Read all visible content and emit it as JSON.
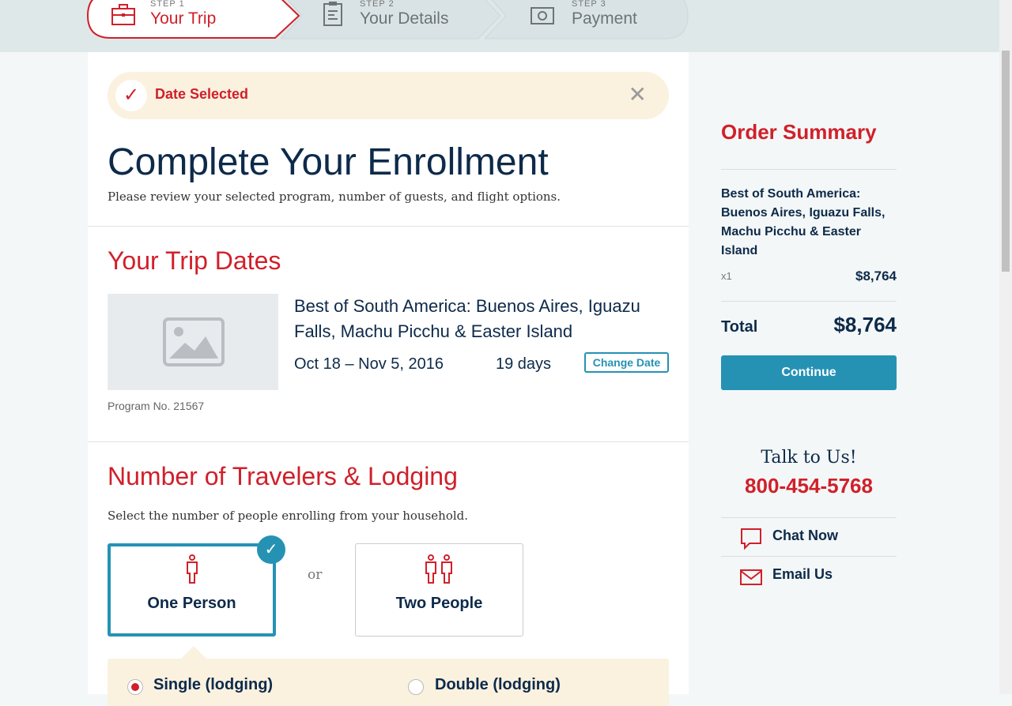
{
  "steps": [
    {
      "label": "STEP 1",
      "title": "Your Trip",
      "icon": "briefcase-icon"
    },
    {
      "label": "STEP 2",
      "title": "Your Details",
      "icon": "clipboard-icon"
    },
    {
      "label": "STEP 3",
      "title": "Payment",
      "icon": "money-icon"
    }
  ],
  "alert": {
    "text": "Date Selected"
  },
  "page": {
    "title": "Complete Your Enrollment",
    "subtitle": "Please review your selected program, number of guests, and flight options."
  },
  "trip": {
    "heading": "Your Trip Dates",
    "program_name": "Best of South America: Buenos Aires, Iguazu Falls, Machu Picchu & Easter Island",
    "dates": "Oct 18 – Nov 5, 2016",
    "duration": "19 days",
    "change_label": "Change Date",
    "program_no": "Program No. 21567"
  },
  "travelers": {
    "heading": "Number of Travelers & Lodging",
    "desc": "Select the number of people enrolling from your household.",
    "one": "One Person",
    "or": "or",
    "two": "Two People",
    "single": "Single (lodging)",
    "double": "Double (lodging)"
  },
  "summary": {
    "title": "Order Summary",
    "item": "Best of South America: Buenos Aires, Iguazu Falls, Machu Picchu & Easter Island",
    "qty": "x1",
    "item_price": "$8,764",
    "total_label": "Total",
    "total": "$8,764",
    "continue": "Continue"
  },
  "contact": {
    "talk": "Talk to Us!",
    "phone": "800-454-5768",
    "chat": "Chat Now",
    "email": "Email Us"
  },
  "colors": {
    "accent": "#d0202a",
    "primary": "#2592b4",
    "navy": "#0d2a4a"
  }
}
